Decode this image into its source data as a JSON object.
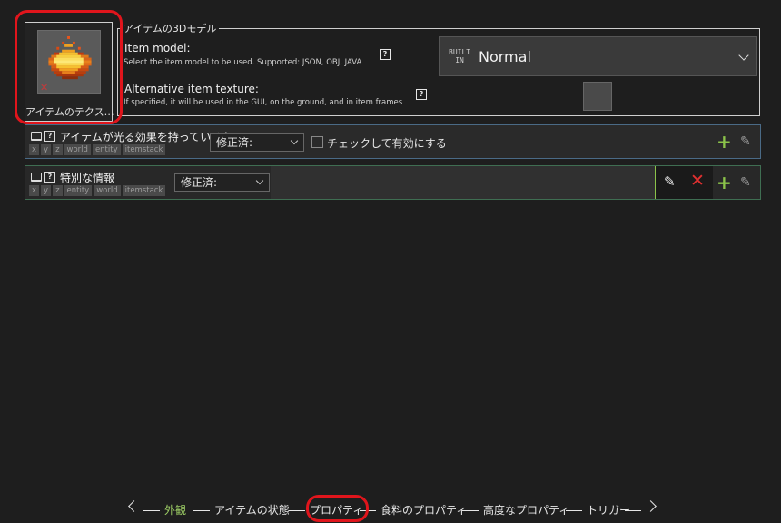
{
  "texture": {
    "label": "アイテムのテクス…",
    "missing_mark": "✕"
  },
  "model": {
    "legend": "アイテムの3Dモデル",
    "item_model_title": "Item model:",
    "item_model_desc": "Select the item model to be used. Supported: JSON, OBJ, JAVA",
    "item_model_help": "?",
    "selected_prefix_line1": "BUILT",
    "selected_prefix_line2": "IN",
    "selected_value": "Normal",
    "alt_texture_title": "Alternative item texture:",
    "alt_texture_desc": "If specified, it will be used in the GUI, on the ground, and in item frames",
    "alt_texture_help": "?"
  },
  "rows": [
    {
      "help": "?",
      "label": "アイテムが光る効果を持っているか",
      "chips": [
        "x",
        "y",
        "z",
        "world",
        "entity",
        "itemstack"
      ],
      "state": "修正済:",
      "checkbox_label": "チェックして有効にする"
    },
    {
      "help": "?",
      "label": "特別な情報",
      "chips": [
        "x",
        "y",
        "z",
        "entity",
        "world",
        "itemstack"
      ],
      "state": "修正済:"
    }
  ],
  "icons": {
    "monitor": "monitor-icon",
    "plus": "+",
    "pencil": "✎",
    "delete": "✕"
  },
  "wizard": {
    "steps": [
      "外観",
      "アイテムの状態",
      "プロパティ",
      "食料のプロパティ",
      "高度なプロパティ",
      "トリガー"
    ],
    "active_index": 0,
    "highlighted_index": 2
  },
  "colors": {
    "accent_green": "#9ccc65",
    "highlight_red": "#e0151c",
    "row1_border": "#4a6a86",
    "row2_border": "#3f6e52"
  }
}
